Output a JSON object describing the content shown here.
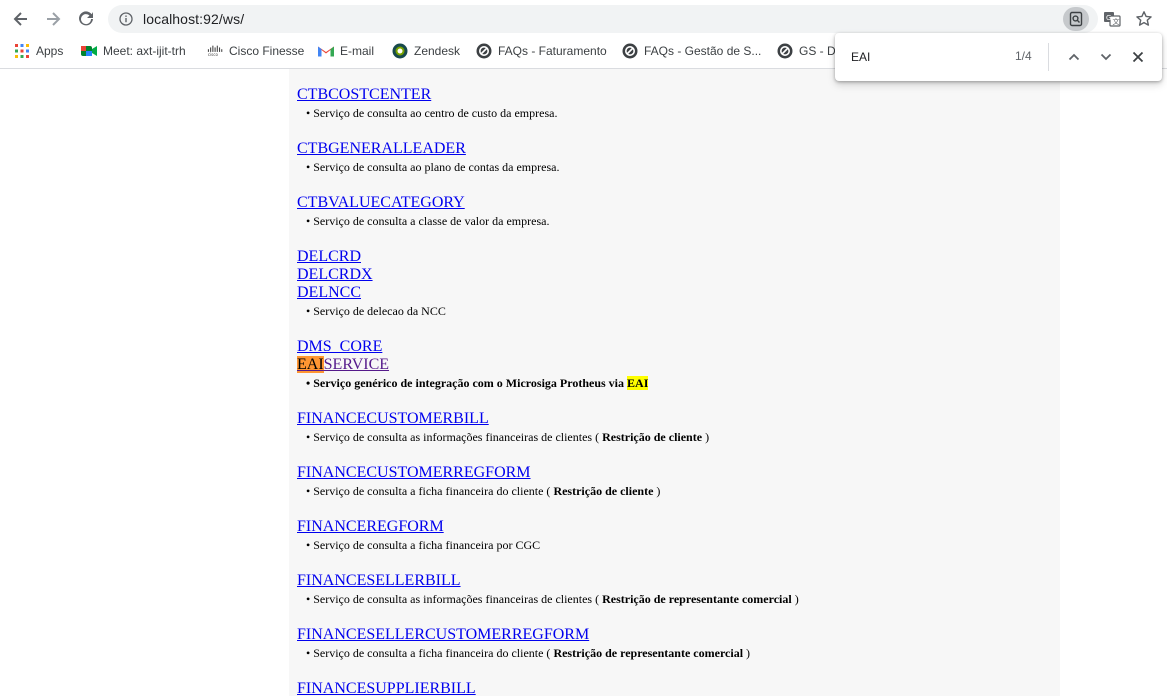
{
  "browser": {
    "url": "localhost:92/ws/"
  },
  "bookmarks": [
    {
      "label": "Apps",
      "icon": "apps-grid-icon"
    },
    {
      "label": "Meet: axt-ijit-trh",
      "icon": "meet-icon"
    },
    {
      "label": "Cisco Finesse",
      "icon": "cisco-icon"
    },
    {
      "label": "E-mail",
      "icon": "gmail-icon"
    },
    {
      "label": "Zendesk",
      "icon": "zendesk-icon"
    },
    {
      "label": "FAQs - Faturamento",
      "icon": "faq-icon"
    },
    {
      "label": "FAQs - Gestão de S...",
      "icon": "faq-icon"
    },
    {
      "label": "GS - D",
      "icon": "faq-icon"
    }
  ],
  "find": {
    "query": "EAI",
    "count": "1/4"
  },
  "services": [
    {
      "name": "CTBCOSTCENTER",
      "desc": "Serviço de consulta ao centro de custo da empresa."
    },
    {
      "name": "CTBGENERALLEADER",
      "desc": "Serviço de consulta ao plano de contas da empresa."
    },
    {
      "name": "CTBVALUECATEGORY",
      "desc": "Serviço de consulta a classe de valor da empresa."
    },
    {
      "name": "DELCRD"
    },
    {
      "name": "DELCRDX"
    },
    {
      "name": "DELNCC",
      "desc": "Serviço de delecao da NCC"
    },
    {
      "name": "DMS_CORE"
    },
    {
      "name_match": "EAI",
      "name_rest": "SERVICE",
      "desc_main": "Serviço genérico de integração com o Microsiga Protheus via ",
      "desc_match": "EAI"
    },
    {
      "name": "FINANCECUSTOMERBILL",
      "desc": "Serviço de consulta as informações financeiras de clientes (",
      "desc_bold": "Restrição de cliente",
      "desc_end": ")"
    },
    {
      "name": "FINANCECUSTOMERREGFORM",
      "desc": "Serviço de consulta a ficha financeira do cliente (",
      "desc_bold": "Restrição de cliente",
      "desc_end": ")"
    },
    {
      "name": "FINANCEREGFORM",
      "desc": "Serviço de consulta a ficha financeira por CGC"
    },
    {
      "name": "FINANCESELLERBILL",
      "desc": "Serviço de consulta as informações financeiras de clientes (",
      "desc_bold": "Restrição de representante comercial",
      "desc_end": ")"
    },
    {
      "name": "FINANCESELLERCUSTOMERREGFORM",
      "desc": "Serviço de consulta a ficha financeira do cliente (",
      "desc_bold": "Restrição de representante comercial",
      "desc_end": ")"
    },
    {
      "name": "FINANCESUPPLIERBILL"
    }
  ],
  "colors": {
    "link": "#0000ee",
    "visited_link": "#551a8b",
    "find_current": "#ff9632",
    "find_match": "#ffff00",
    "panel_bg": "#f7f7f7"
  }
}
